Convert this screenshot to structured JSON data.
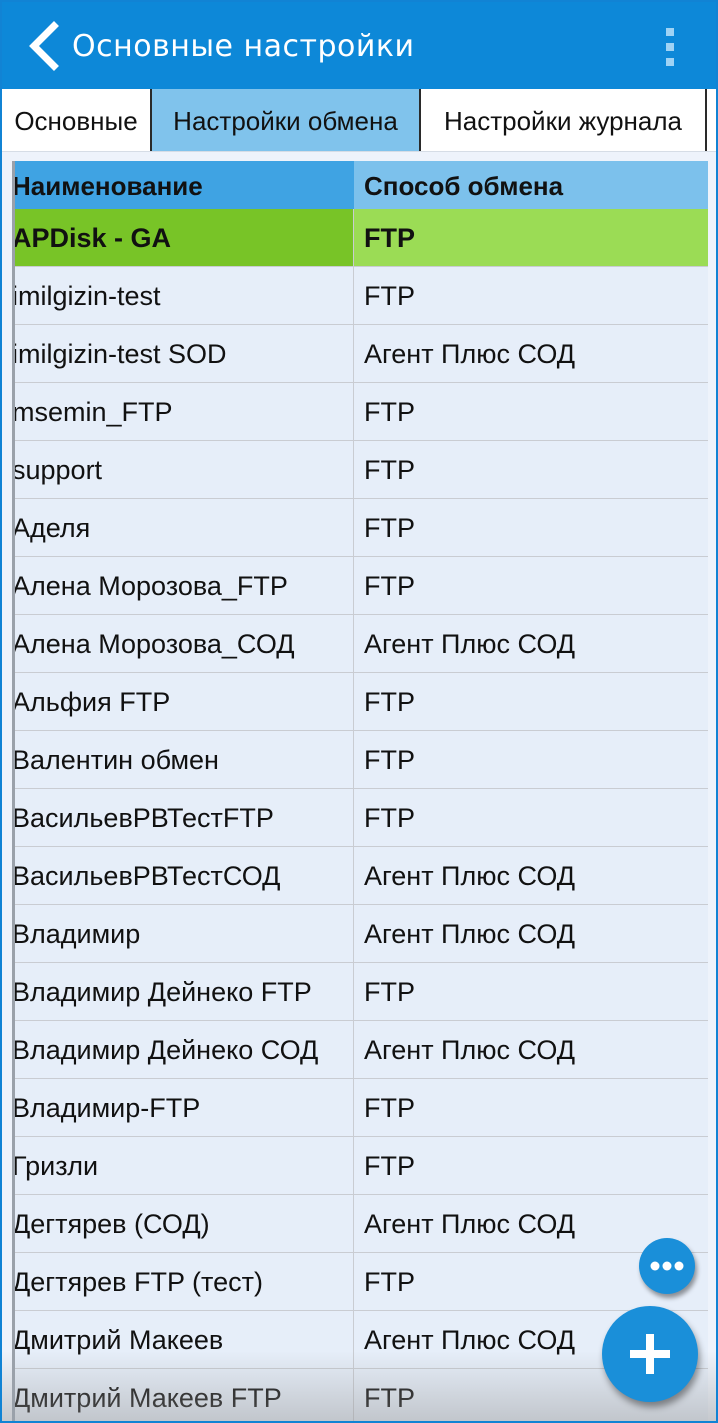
{
  "appbar": {
    "title": "Основные настройки",
    "back_icon": "chevron-left-icon",
    "menu_icon": "more-vertical-icon",
    "color": "#0d88d8"
  },
  "tabs": [
    {
      "label": "Основные",
      "active": false
    },
    {
      "label": "Настройки обмена",
      "active": true
    },
    {
      "label": "Настройки журнала",
      "active": false
    }
  ],
  "table": {
    "columns": [
      "Наименование",
      "Способ обмена"
    ],
    "selected_color": "#78c427",
    "rows": [
      {
        "name": "APDisk - GA",
        "method": "FTP",
        "selected": true
      },
      {
        "name": "imilgizin-test",
        "method": "FTP"
      },
      {
        "name": "imilgizin-test SOD",
        "method": "Агент Плюс СОД"
      },
      {
        "name": "msemin_FTP",
        "method": "FTP"
      },
      {
        "name": "support",
        "method": "FTP"
      },
      {
        "name": "Аделя",
        "method": "FTP"
      },
      {
        "name": "Алена Морозова_FTP",
        "method": "FTP"
      },
      {
        "name": "Алена Морозова_СОД",
        "method": "Агент Плюс СОД"
      },
      {
        "name": "Альфия FTP",
        "method": "FTP"
      },
      {
        "name": "Валентин обмен",
        "method": "FTP"
      },
      {
        "name": "ВасильевРВТестFTP",
        "method": "FTP"
      },
      {
        "name": "ВасильевРВТестСОД",
        "method": "Агент Плюс СОД"
      },
      {
        "name": "Владимир",
        "method": "Агент Плюс СОД"
      },
      {
        "name": "Владимир Дейнеко FTP",
        "method": "FTP"
      },
      {
        "name": "Владимир Дейнеко СОД",
        "method": "Агент Плюс СОД"
      },
      {
        "name": "Владимир-FTP",
        "method": "FTP"
      },
      {
        "name": "Гризли",
        "method": "FTP"
      },
      {
        "name": "Дегтярев (СОД)",
        "method": "Агент Плюс СОД"
      },
      {
        "name": "Дегтярев FTP (тест)",
        "method": "FTP"
      },
      {
        "name": "Дмитрий Макеев",
        "method": "Агент Плюс СОД"
      },
      {
        "name": "Дмитрий Макеев FTP",
        "method": "FTP"
      }
    ]
  },
  "fab": {
    "more_icon": "more-horizontal-icon",
    "add_icon": "plus-icon",
    "color": "#1a8fd9"
  }
}
